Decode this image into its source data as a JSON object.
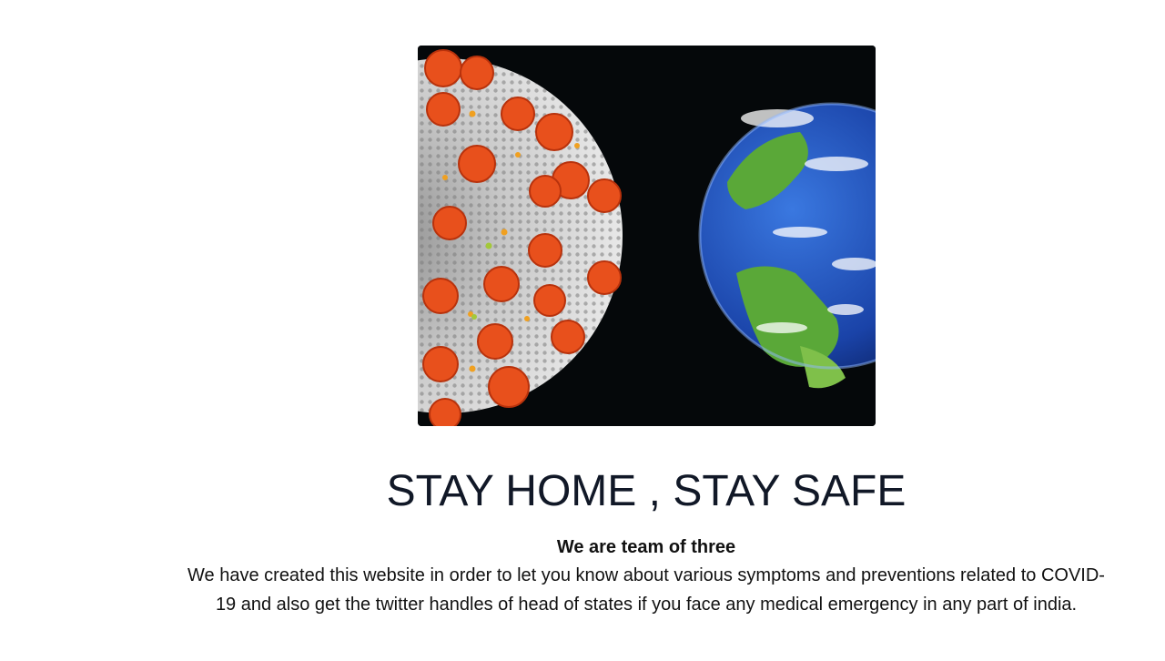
{
  "hero": {
    "image_icon": "virus-and-earth-image"
  },
  "headline": "STAY HOME , STAY SAFE",
  "about": {
    "subheading": "We are team of three",
    "description": "We have created this website in order to let you know about various symptoms and preventions related to COVID-19 and also get the twitter handles of head of states if you face any medical emergency in any part of india."
  },
  "colors": {
    "headline": "#111827",
    "image_background": "#05080a",
    "virus_spike": "#e8501c",
    "earth_ocean": "#1e4fb8",
    "earth_land": "#5aa838"
  }
}
